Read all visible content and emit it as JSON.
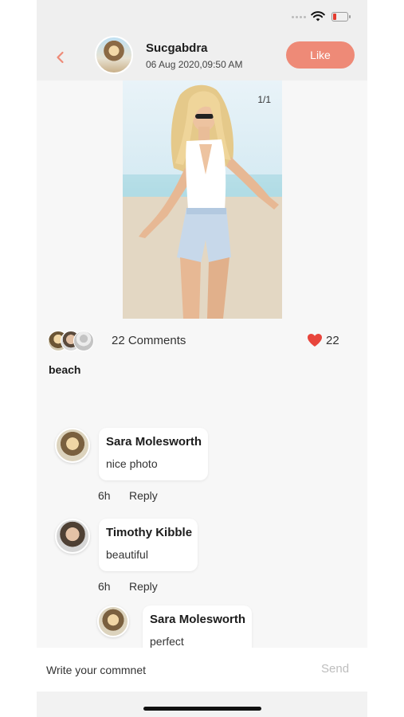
{
  "header": {
    "username": "Sucgabdra",
    "date": "06 Aug 2020,09:50 AM",
    "like_label": "Like"
  },
  "post": {
    "image_counter": "1/1",
    "comments_count": "22 Comments",
    "likes_count": "22",
    "caption": "beach"
  },
  "comments": [
    {
      "name": "Sara Molesworth",
      "text": "nice photo",
      "time": "6h",
      "reply": "Reply"
    },
    {
      "name": "Timothy Kibble",
      "text": "beautiful",
      "time": "6h",
      "reply": "Reply"
    },
    {
      "name": "Sara Molesworth",
      "text": "perfect"
    }
  ],
  "input": {
    "placeholder": "Write your commnet",
    "send_label": "Send"
  },
  "colors": {
    "accent": "#ee8a77",
    "heart": "#e8453c",
    "battery_low": "#e33b2e"
  },
  "icons": {
    "back": "chevron-left-icon",
    "wifi": "wifi-icon",
    "battery": "battery-icon",
    "heart": "heart-icon"
  }
}
